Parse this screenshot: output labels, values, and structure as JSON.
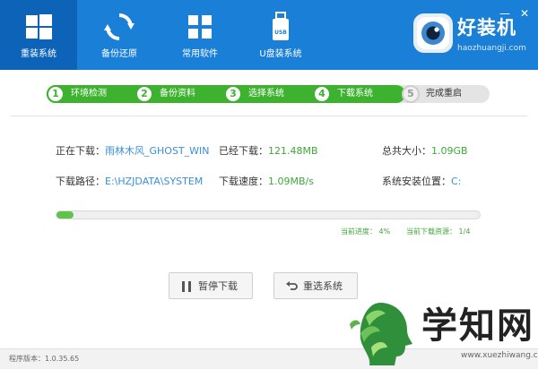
{
  "nav": {
    "items": [
      {
        "label": "重装系统",
        "icon": "windows-icon"
      },
      {
        "label": "备份还原",
        "icon": "refresh-icon"
      },
      {
        "label": "常用软件",
        "icon": "grid-icon"
      },
      {
        "label": "U盘装系统",
        "icon": "usb-icon"
      }
    ]
  },
  "brand": {
    "name": "好装机",
    "url": "haozhuangji.com"
  },
  "window": {
    "minimize": "—",
    "close": "✕"
  },
  "steps": [
    {
      "num": "1",
      "label": "环境检测"
    },
    {
      "num": "2",
      "label": "备份资料"
    },
    {
      "num": "3",
      "label": "选择系统"
    },
    {
      "num": "4",
      "label": "下载系统"
    },
    {
      "num": "5",
      "label": "完成重启"
    }
  ],
  "download": {
    "downloading_label": "正在下载：",
    "downloading_value": "雨林木风_GHOST_WIN",
    "downloaded_label": "已经下载：",
    "downloaded_value": "121.48MB",
    "total_label": "总共大小：",
    "total_value": "1.09GB",
    "path_label": "下载路径：",
    "path_value": "E:\\HZJDATA\\SYSTEM",
    "speed_label": "下载速度：",
    "speed_value": "1.09MB/s",
    "install_label": "系统安装位置：",
    "install_value": "C:"
  },
  "progress": {
    "fraction": 0.04,
    "current_label": "当前进度：",
    "current_value": "4%",
    "resource_label": "当前下载资源：",
    "resource_value": "1/4"
  },
  "buttons": {
    "pause": "暂停下载",
    "reselect": "重选系统"
  },
  "footer": {
    "version": "程序版本：1.0.35.65"
  },
  "watermark": {
    "text": "学知网",
    "url": "www.xuezhiwang.com"
  },
  "colors": {
    "primary": "#1a7fd6",
    "active_nav": "#0d63b8",
    "green": "#3cb22f",
    "blue_text": "#3a8fd9"
  }
}
